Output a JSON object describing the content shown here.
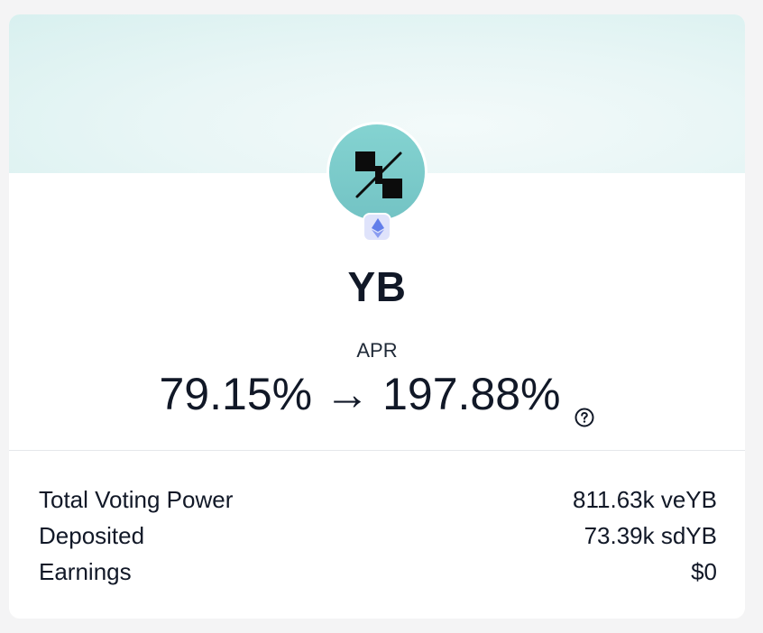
{
  "token": {
    "name": "YB",
    "logo_icon": "yb-token-logo-icon",
    "chain_icon": "ethereum-icon"
  },
  "apr": {
    "label": "APR",
    "current": "79.15%",
    "arrow": "→",
    "boosted": "197.88%",
    "help_icon": "question-circle-icon"
  },
  "stats": [
    {
      "label": "Total Voting Power",
      "value": "811.63k veYB"
    },
    {
      "label": "Deposited",
      "value": "73.39k sdYB"
    },
    {
      "label": "Earnings",
      "value": "$0"
    }
  ],
  "colors": {
    "banner": "#e9f6f6",
    "logo_bg": "#7ccbca",
    "chain_badge_bg": "#dfe3fb",
    "ethereum": "#627eea",
    "text": "#111827"
  }
}
